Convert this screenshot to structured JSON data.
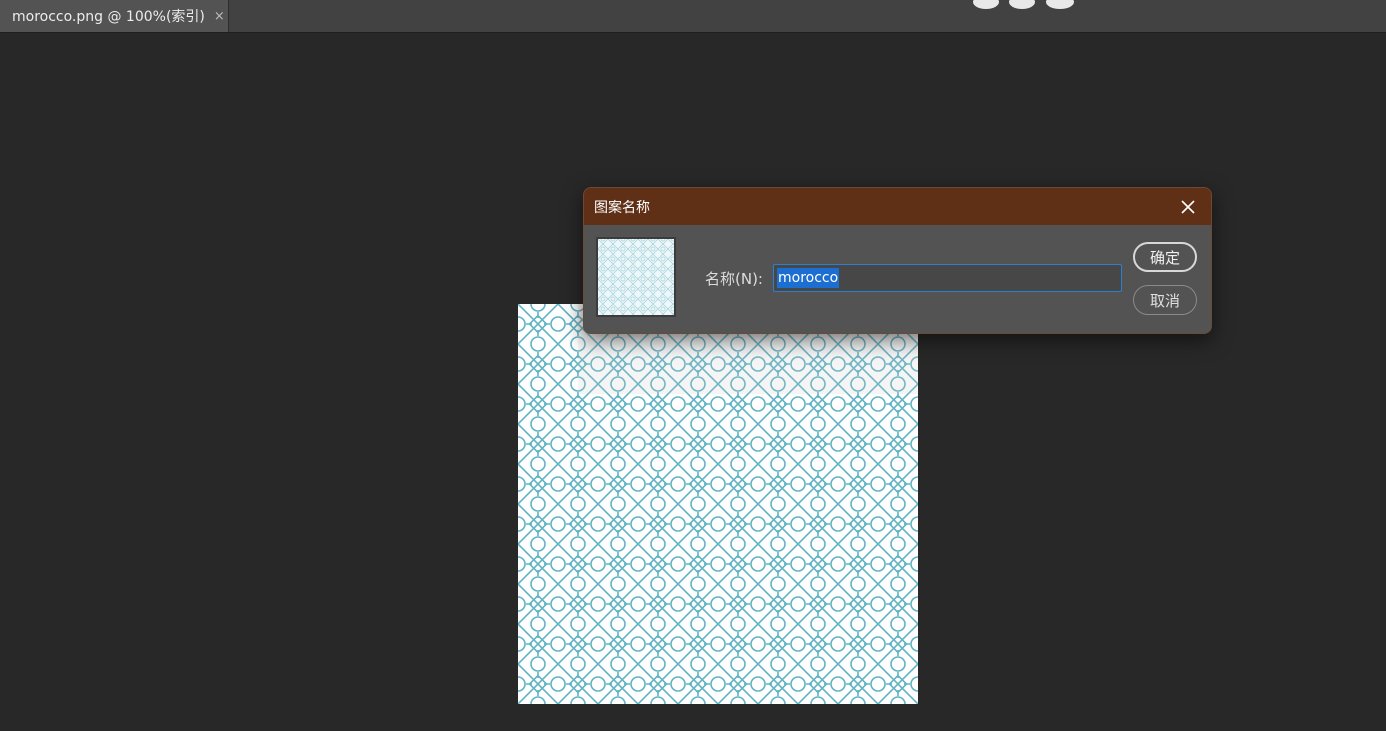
{
  "document_tab": {
    "title": "morocco.png @ 100%(索引)",
    "close_glyph": "×"
  },
  "dialog": {
    "title": "图案名称",
    "close_icon": "close-icon",
    "name_label": "名称(N):",
    "name_value": "morocco",
    "ok_label": "确定",
    "cancel_label": "取消"
  },
  "colors": {
    "pattern_stroke": "#5fb3c4",
    "dialog_title_bg": "#5f2f16",
    "selection": "#1c6fd0"
  }
}
